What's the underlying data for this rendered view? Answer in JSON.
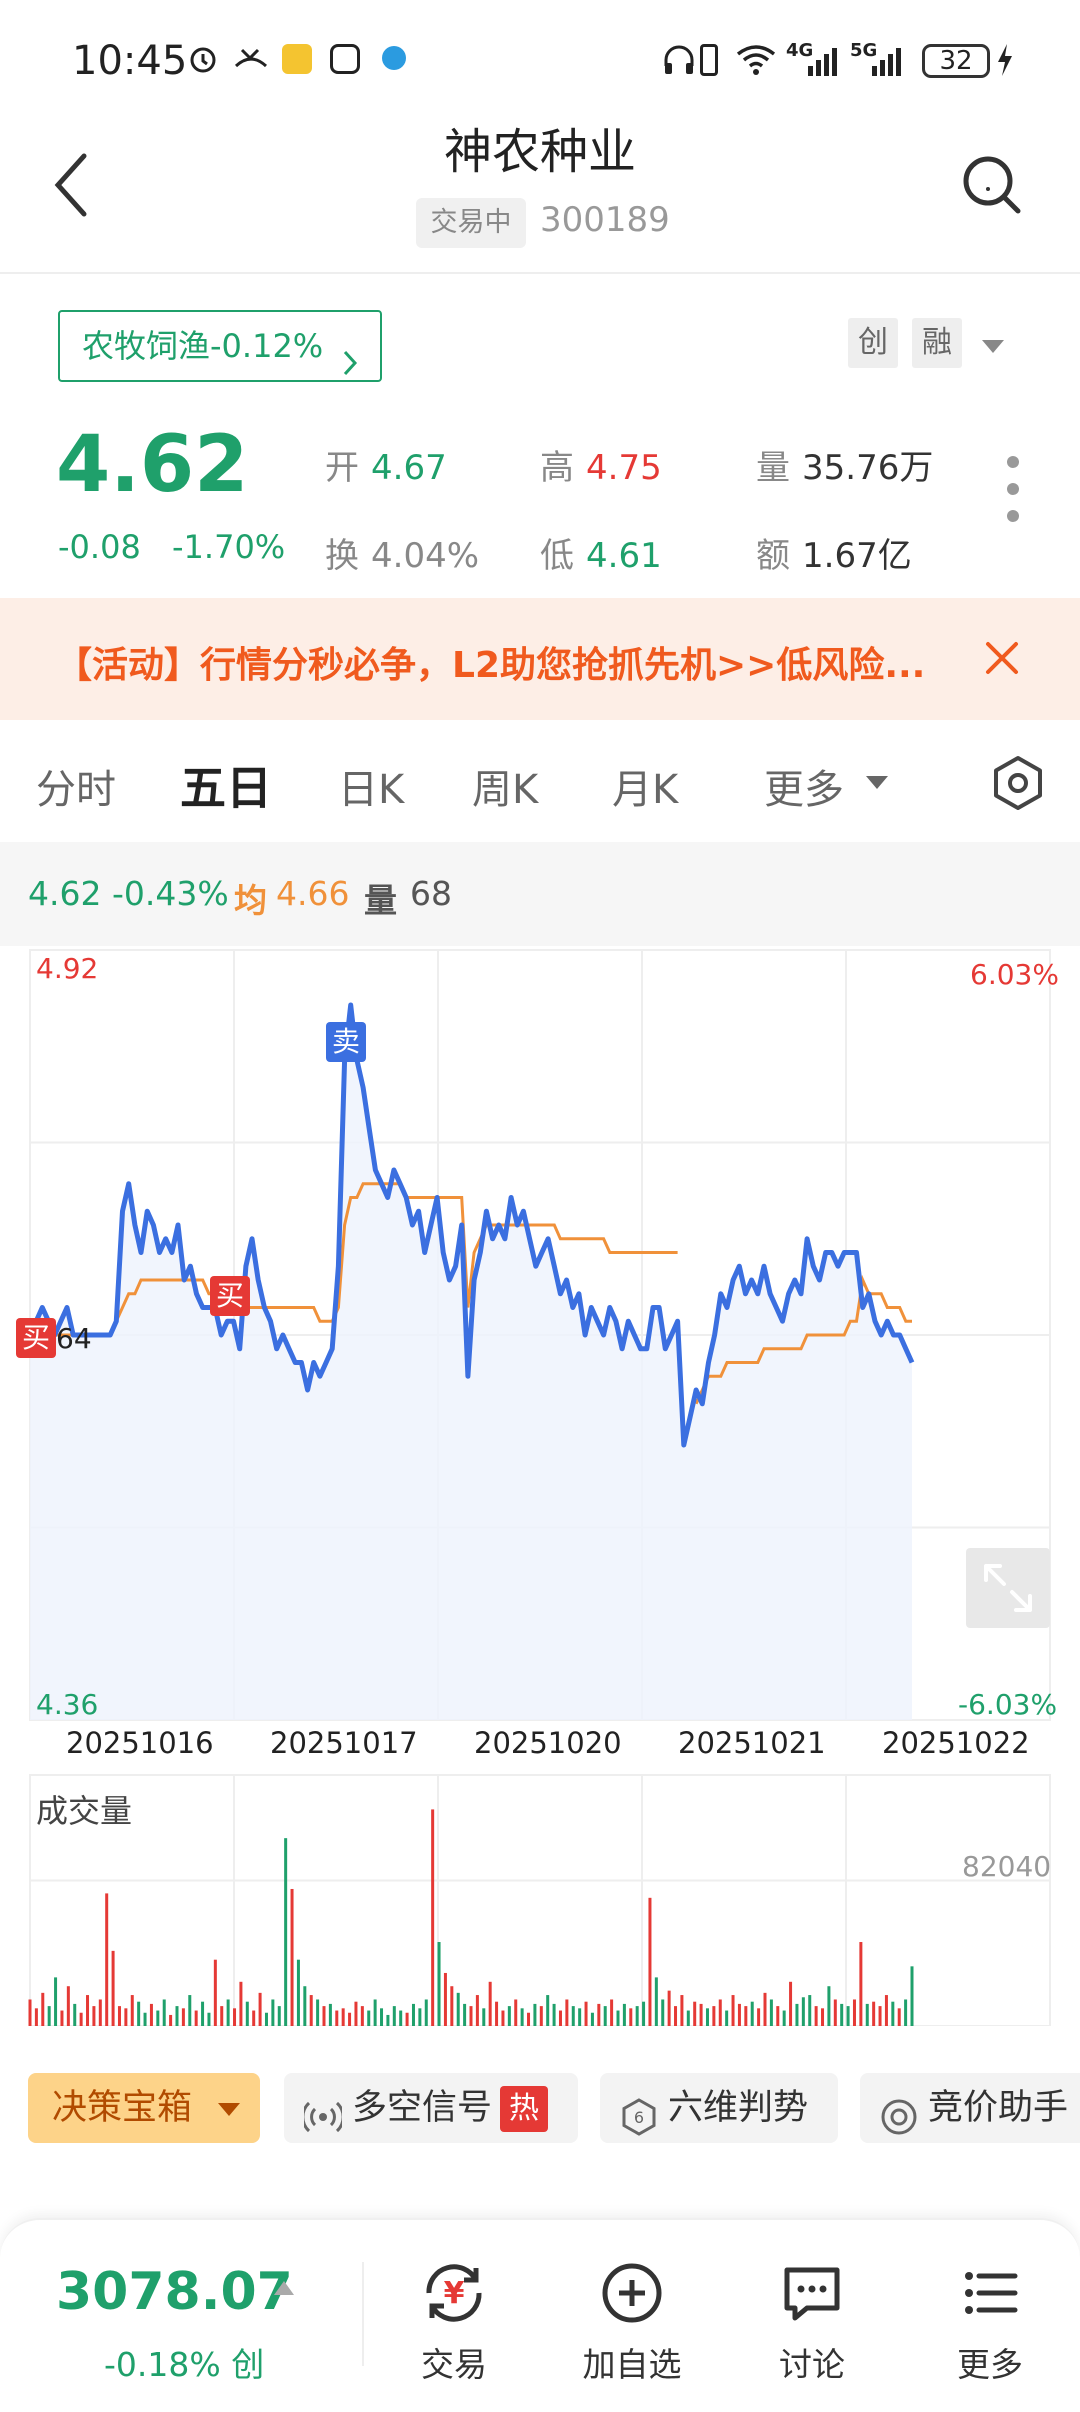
{
  "status_bar": {
    "time": "10:45",
    "icons": [
      "alarm-icon",
      "missed-call-icon",
      "app-notification-icon",
      "hand-icon",
      "browser-icon",
      "headphones-icon",
      "vibrate-icon",
      "wifi-icon",
      "signal-4g-icon",
      "signal-5g-icon",
      "charging-icon"
    ],
    "net1": "4G",
    "net2": "5G",
    "battery": "32"
  },
  "header": {
    "title": "神农种业",
    "status_badge": "交易中",
    "code": "300189"
  },
  "sector": {
    "label": "农牧饲渔-0.12%"
  },
  "tags": [
    "创",
    "融"
  ],
  "quote": {
    "price": "4.62",
    "change": "-0.08",
    "change_pct": "-1.70%",
    "open_label": "开",
    "open": "4.67",
    "high_label": "高",
    "high": "4.75",
    "volume_label": "量",
    "volume": "35.76万",
    "turnover_label": "换",
    "turnover": "4.04%",
    "low_label": "低",
    "low": "4.61",
    "amount_label": "额",
    "amount": "1.67亿"
  },
  "banner": {
    "text": "【活动】行情分秒必争，L2助您抢抓先机>>低风险..."
  },
  "period_tabs": [
    "分时",
    "五日",
    "日K",
    "周K",
    "月K",
    "更多"
  ],
  "active_tab": "五日",
  "quote_strip": {
    "price": "4.62",
    "pct": "-0.43%",
    "avg_label": "均",
    "avg": "4.66",
    "vol_label": "量",
    "vol": "68"
  },
  "chart_labels": {
    "y_high": "4.92",
    "y_low": "4.36",
    "pct_high": "6.03%",
    "pct_low": "-6.03%",
    "prev_close_fragment": "64",
    "buy_marker": "买",
    "sell_marker": "卖",
    "volume_title": "成交量",
    "volume_max": "82040"
  },
  "chart_data": {
    "type": "line",
    "x_days": [
      "20251016",
      "20251017",
      "20251020",
      "20251021",
      "20251022"
    ],
    "ylim": [
      4.36,
      4.92
    ],
    "pct_range": [
      "-6.03%",
      "6.03%"
    ],
    "reference_price": 4.64,
    "series": [
      {
        "color": "#3b6fe0",
        "values": [
          4.64,
          4.65,
          4.66,
          4.65,
          4.64,
          4.65,
          4.66,
          4.64,
          4.64,
          4.64,
          4.64,
          4.64,
          4.64,
          4.64,
          4.65,
          4.73,
          4.75,
          4.72,
          4.7,
          4.73,
          4.72,
          4.7,
          4.71,
          4.7,
          4.72,
          4.68,
          4.69,
          4.67,
          4.66,
          4.66,
          4.66,
          4.64,
          4.65,
          4.65,
          4.63,
          4.69,
          4.71,
          4.68,
          4.66,
          4.65,
          4.63,
          4.64,
          4.63,
          4.62,
          4.62,
          4.6,
          4.62,
          4.61,
          4.62,
          4.63,
          4.69,
          4.84,
          4.88,
          4.84,
          4.82,
          4.79,
          4.76,
          4.75,
          4.74,
          4.76,
          4.75,
          4.74,
          4.72,
          4.73,
          4.7,
          4.72,
          4.74,
          4.7,
          4.68,
          4.69,
          4.72,
          4.61,
          4.68,
          4.7,
          4.73,
          4.71,
          4.72,
          4.71,
          4.74,
          4.72,
          4.73,
          4.71,
          4.69,
          4.7,
          4.71,
          4.69,
          4.67,
          4.68,
          4.66,
          4.67,
          4.64,
          4.66,
          4.65,
          4.64,
          4.66,
          4.65,
          4.63,
          4.65,
          4.64,
          4.63,
          4.63,
          4.66,
          4.66,
          4.63,
          4.64,
          4.65,
          4.56,
          4.58,
          4.6,
          4.59,
          4.62,
          4.64,
          4.67,
          4.66,
          4.68,
          4.69,
          4.67,
          4.68,
          4.67,
          4.69,
          4.67,
          4.66,
          4.65,
          4.67,
          4.68,
          4.67,
          4.71,
          4.69,
          4.68,
          4.7,
          4.7,
          4.69,
          4.7,
          4.7,
          4.7,
          4.66,
          4.67,
          4.65,
          4.64,
          4.65,
          4.64,
          4.64,
          4.63,
          4.62
        ]
      },
      {
        "color": "#f0913a",
        "values": [
          4.64,
          4.64,
          4.64,
          4.64,
          4.64,
          4.64,
          4.64,
          4.64,
          4.64,
          4.64,
          4.64,
          4.64,
          4.64,
          4.64,
          4.65,
          4.66,
          4.67,
          4.67,
          4.68,
          4.68,
          4.68,
          4.68,
          4.68,
          4.68,
          4.68,
          4.68,
          4.68,
          4.68,
          4.68,
          4.67,
          4.67,
          4.67,
          4.67,
          4.66,
          4.66,
          4.66,
          4.66,
          4.66,
          4.66,
          4.66,
          4.66,
          4.66,
          4.66,
          4.66,
          4.66,
          4.66,
          4.66,
          4.65,
          4.65,
          4.65,
          4.66,
          4.72,
          4.74,
          4.74,
          4.75,
          4.75,
          4.75,
          4.75,
          4.75,
          4.75,
          4.75,
          4.74,
          4.74,
          4.74,
          4.74,
          4.74,
          4.74,
          4.74,
          4.74,
          4.74,
          4.74,
          4.66,
          4.7,
          4.71,
          4.72,
          4.72,
          4.72,
          4.72,
          4.72,
          4.72,
          4.72,
          4.72,
          4.72,
          4.72,
          4.72,
          4.72,
          4.71,
          4.71,
          4.71,
          4.71,
          4.71,
          4.71,
          4.71,
          4.71,
          4.7,
          4.7,
          4.7,
          4.7,
          4.7,
          4.7,
          4.7,
          4.7,
          4.7,
          4.7,
          4.7,
          4.7,
          null,
          null,
          4.59,
          4.6,
          4.61,
          4.61,
          4.61,
          4.62,
          4.62,
          4.62,
          4.62,
          4.62,
          4.62,
          4.63,
          4.63,
          4.63,
          4.63,
          4.63,
          4.63,
          4.63,
          4.64,
          4.64,
          4.64,
          4.64,
          4.64,
          4.64,
          4.64,
          4.65,
          4.65,
          4.68,
          4.67,
          4.67,
          4.67,
          4.66,
          4.66,
          4.66,
          4.65,
          4.65
        ]
      }
    ],
    "volume": {
      "max": 82040,
      "values": [
        12,
        8,
        15,
        9,
        22,
        7,
        18,
        10,
        6,
        14,
        9,
        12,
        60,
        34,
        9,
        8,
        14,
        11,
        6,
        10,
        7,
        12,
        5,
        9,
        8,
        14,
        7,
        11,
        6,
        30,
        9,
        12,
        8,
        20,
        11,
        7,
        15,
        6,
        12,
        9,
        85,
        62,
        30,
        18,
        14,
        12,
        9,
        10,
        7,
        8,
        6,
        11,
        9,
        7,
        12,
        8,
        5,
        9,
        7,
        6,
        10,
        8,
        12,
        98,
        38,
        24,
        18,
        15,
        10,
        9,
        14,
        8,
        20,
        11,
        7,
        9,
        12,
        8,
        6,
        10,
        9,
        14,
        10,
        7,
        12,
        9,
        8,
        11,
        6,
        10,
        9,
        12,
        7,
        10,
        8,
        9,
        11,
        58,
        22,
        12,
        16,
        9,
        14,
        7,
        11,
        10,
        8,
        9,
        12,
        7,
        14,
        10,
        9,
        11,
        8,
        15,
        12,
        9,
        7,
        20,
        10,
        13,
        14,
        9,
        8,
        18,
        12,
        10,
        9,
        12,
        38,
        10,
        11,
        9,
        14,
        11,
        8,
        12,
        27
      ]
    }
  },
  "tools": {
    "decision_box": "决策宝箱",
    "long_short": "多空信号",
    "hot_badge": "热",
    "six_dim": "六维判势",
    "auction": "竞价助手"
  },
  "bottom": {
    "index_value": "3078.07",
    "index_change": "-0.18%",
    "index_tag": "创",
    "nav": [
      "交易",
      "加自选",
      "讨论",
      "更多"
    ]
  },
  "colors": {
    "green": "#1fa06b",
    "red": "#e53935",
    "price_line": "#3b6fe0",
    "avg_line": "#f0913a",
    "banner_bg": "#fdeee6",
    "banner_text": "#f05a1e"
  }
}
